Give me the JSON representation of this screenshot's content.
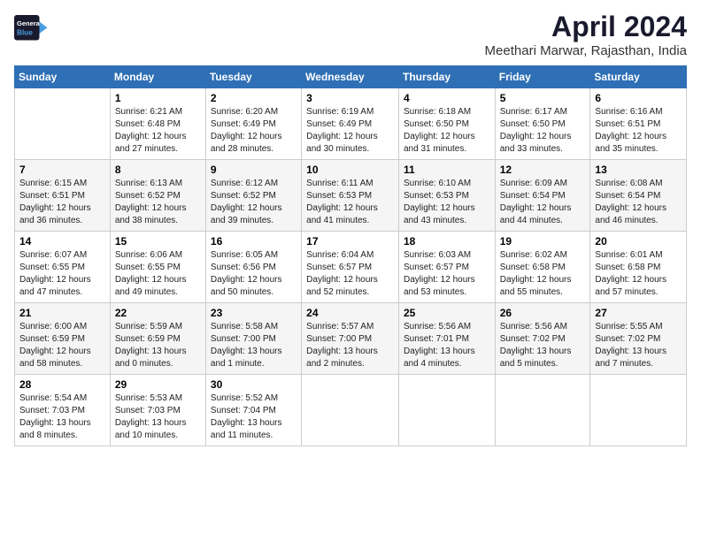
{
  "logo": {
    "line1": "General",
    "line2": "Blue"
  },
  "title": "April 2024",
  "subtitle": "Meethari Marwar, Rajasthan, India",
  "headers": [
    "Sunday",
    "Monday",
    "Tuesday",
    "Wednesday",
    "Thursday",
    "Friday",
    "Saturday"
  ],
  "weeks": [
    [
      {
        "day": "",
        "text": ""
      },
      {
        "day": "1",
        "text": "Sunrise: 6:21 AM\nSunset: 6:48 PM\nDaylight: 12 hours\nand 27 minutes."
      },
      {
        "day": "2",
        "text": "Sunrise: 6:20 AM\nSunset: 6:49 PM\nDaylight: 12 hours\nand 28 minutes."
      },
      {
        "day": "3",
        "text": "Sunrise: 6:19 AM\nSunset: 6:49 PM\nDaylight: 12 hours\nand 30 minutes."
      },
      {
        "day": "4",
        "text": "Sunrise: 6:18 AM\nSunset: 6:50 PM\nDaylight: 12 hours\nand 31 minutes."
      },
      {
        "day": "5",
        "text": "Sunrise: 6:17 AM\nSunset: 6:50 PM\nDaylight: 12 hours\nand 33 minutes."
      },
      {
        "day": "6",
        "text": "Sunrise: 6:16 AM\nSunset: 6:51 PM\nDaylight: 12 hours\nand 35 minutes."
      }
    ],
    [
      {
        "day": "7",
        "text": "Sunrise: 6:15 AM\nSunset: 6:51 PM\nDaylight: 12 hours\nand 36 minutes."
      },
      {
        "day": "8",
        "text": "Sunrise: 6:13 AM\nSunset: 6:52 PM\nDaylight: 12 hours\nand 38 minutes."
      },
      {
        "day": "9",
        "text": "Sunrise: 6:12 AM\nSunset: 6:52 PM\nDaylight: 12 hours\nand 39 minutes."
      },
      {
        "day": "10",
        "text": "Sunrise: 6:11 AM\nSunset: 6:53 PM\nDaylight: 12 hours\nand 41 minutes."
      },
      {
        "day": "11",
        "text": "Sunrise: 6:10 AM\nSunset: 6:53 PM\nDaylight: 12 hours\nand 43 minutes."
      },
      {
        "day": "12",
        "text": "Sunrise: 6:09 AM\nSunset: 6:54 PM\nDaylight: 12 hours\nand 44 minutes."
      },
      {
        "day": "13",
        "text": "Sunrise: 6:08 AM\nSunset: 6:54 PM\nDaylight: 12 hours\nand 46 minutes."
      }
    ],
    [
      {
        "day": "14",
        "text": "Sunrise: 6:07 AM\nSunset: 6:55 PM\nDaylight: 12 hours\nand 47 minutes."
      },
      {
        "day": "15",
        "text": "Sunrise: 6:06 AM\nSunset: 6:55 PM\nDaylight: 12 hours\nand 49 minutes."
      },
      {
        "day": "16",
        "text": "Sunrise: 6:05 AM\nSunset: 6:56 PM\nDaylight: 12 hours\nand 50 minutes."
      },
      {
        "day": "17",
        "text": "Sunrise: 6:04 AM\nSunset: 6:57 PM\nDaylight: 12 hours\nand 52 minutes."
      },
      {
        "day": "18",
        "text": "Sunrise: 6:03 AM\nSunset: 6:57 PM\nDaylight: 12 hours\nand 53 minutes."
      },
      {
        "day": "19",
        "text": "Sunrise: 6:02 AM\nSunset: 6:58 PM\nDaylight: 12 hours\nand 55 minutes."
      },
      {
        "day": "20",
        "text": "Sunrise: 6:01 AM\nSunset: 6:58 PM\nDaylight: 12 hours\nand 57 minutes."
      }
    ],
    [
      {
        "day": "21",
        "text": "Sunrise: 6:00 AM\nSunset: 6:59 PM\nDaylight: 12 hours\nand 58 minutes."
      },
      {
        "day": "22",
        "text": "Sunrise: 5:59 AM\nSunset: 6:59 PM\nDaylight: 13 hours\nand 0 minutes."
      },
      {
        "day": "23",
        "text": "Sunrise: 5:58 AM\nSunset: 7:00 PM\nDaylight: 13 hours\nand 1 minute."
      },
      {
        "day": "24",
        "text": "Sunrise: 5:57 AM\nSunset: 7:00 PM\nDaylight: 13 hours\nand 2 minutes."
      },
      {
        "day": "25",
        "text": "Sunrise: 5:56 AM\nSunset: 7:01 PM\nDaylight: 13 hours\nand 4 minutes."
      },
      {
        "day": "26",
        "text": "Sunrise: 5:56 AM\nSunset: 7:02 PM\nDaylight: 13 hours\nand 5 minutes."
      },
      {
        "day": "27",
        "text": "Sunrise: 5:55 AM\nSunset: 7:02 PM\nDaylight: 13 hours\nand 7 minutes."
      }
    ],
    [
      {
        "day": "28",
        "text": "Sunrise: 5:54 AM\nSunset: 7:03 PM\nDaylight: 13 hours\nand 8 minutes."
      },
      {
        "day": "29",
        "text": "Sunrise: 5:53 AM\nSunset: 7:03 PM\nDaylight: 13 hours\nand 10 minutes."
      },
      {
        "day": "30",
        "text": "Sunrise: 5:52 AM\nSunset: 7:04 PM\nDaylight: 13 hours\nand 11 minutes."
      },
      {
        "day": "",
        "text": ""
      },
      {
        "day": "",
        "text": ""
      },
      {
        "day": "",
        "text": ""
      },
      {
        "day": "",
        "text": ""
      }
    ]
  ]
}
